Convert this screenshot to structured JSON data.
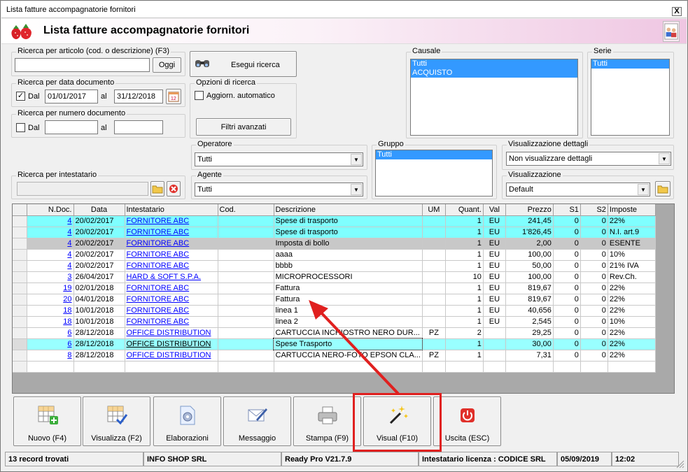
{
  "window": {
    "title": "Lista fatture accompagnatorie fornitori",
    "close_label": "X"
  },
  "header": {
    "title": "Lista fatture accompagnatorie fornitori"
  },
  "search_article": {
    "legend": "Ricerca per articolo (cod. o descrizione) (F3)",
    "value": "",
    "button": "Oggi"
  },
  "search_button": "Esegui ricerca",
  "search_date": {
    "legend": "Ricerca per data documento",
    "checked": true,
    "from_label": "Dal",
    "from": "01/01/2017",
    "to_label": "al",
    "to": "31/12/2018"
  },
  "search_number": {
    "legend": "Ricerca per numero documento",
    "checked": false,
    "from_label": "Dal",
    "from": "",
    "to_label": "al",
    "to": ""
  },
  "options": {
    "legend": "Opzioni di ricerca",
    "auto_update_label": "Aggiorn. automatico",
    "auto_update": false,
    "advanced_filters": "Filtri avanzati"
  },
  "causale": {
    "legend": "Causale",
    "items": [
      "Tutti",
      "ACQUISTO"
    ]
  },
  "serie": {
    "legend": "Serie",
    "items": [
      "Tutti"
    ]
  },
  "operatore": {
    "legend": "Operatore",
    "value": "Tutti"
  },
  "gruppo": {
    "legend": "Gruppo",
    "items": [
      "Tutti"
    ]
  },
  "vis_dettagli": {
    "legend": "Visualizzazione dettagli",
    "value": "Non visualizzare dettagli"
  },
  "intestatario": {
    "legend": "Ricerca per intestatario",
    "value": ""
  },
  "agente": {
    "legend": "Agente",
    "value": "Tutti"
  },
  "visualizzazione": {
    "legend": "Visualizzazione",
    "value": "Default"
  },
  "table": {
    "columns": [
      "N.Doc.",
      "Data",
      "Intestatario",
      "Cod.",
      "Descrizione",
      "UM",
      "Quant.",
      "Val",
      "Prezzo",
      "S1",
      "S2",
      "Imposte"
    ],
    "rows": [
      {
        "style": "cyan",
        "cells": [
          "4",
          "20/02/2017",
          "FORNITORE ABC",
          "",
          "Spese di trasporto",
          "",
          "1",
          "EU",
          "241,45",
          "0",
          "0",
          "22%"
        ]
      },
      {
        "style": "cyan",
        "cells": [
          "4",
          "20/02/2017",
          "FORNITORE ABC",
          "",
          "Spese di trasporto",
          "",
          "1",
          "EU",
          "1'826,45",
          "0",
          "0",
          "N.I. art.9"
        ]
      },
      {
        "style": "gray",
        "cells": [
          "4",
          "20/02/2017",
          "FORNITORE ABC",
          "",
          "Imposta di bollo",
          "",
          "1",
          "EU",
          "2,00",
          "0",
          "0",
          "ESENTE"
        ]
      },
      {
        "style": "",
        "cells": [
          "4",
          "20/02/2017",
          "FORNITORE ABC",
          "",
          "aaaa",
          "",
          "1",
          "EU",
          "100,00",
          "0",
          "0",
          "10%"
        ]
      },
      {
        "style": "",
        "cells": [
          "4",
          "20/02/2017",
          "FORNITORE ABC",
          "",
          "bbbb",
          "",
          "1",
          "EU",
          "50,00",
          "0",
          "0",
          "21% IVA"
        ]
      },
      {
        "style": "",
        "cells": [
          "3",
          "26/04/2017",
          "HARD & SOFT S.P.A.",
          "",
          "MICROPROCESSORI",
          "",
          "10",
          "EU",
          "100,00",
          "0",
          "0",
          "Rev.Ch."
        ]
      },
      {
        "style": "",
        "cells": [
          "19",
          "02/01/2018",
          "FORNITORE ABC",
          "",
          "Fattura",
          "",
          "1",
          "EU",
          "819,67",
          "0",
          "0",
          "22%"
        ]
      },
      {
        "style": "",
        "cells": [
          "20",
          "04/01/2018",
          "FORNITORE ABC",
          "",
          "Fattura",
          "",
          "1",
          "EU",
          "819,67",
          "0",
          "0",
          "22%"
        ]
      },
      {
        "style": "",
        "cells": [
          "18",
          "10/01/2018",
          "FORNITORE ABC",
          "",
          "linea 1",
          "",
          "1",
          "EU",
          "40,656",
          "0",
          "0",
          "22%"
        ]
      },
      {
        "style": "",
        "cells": [
          "18",
          "10/01/2018",
          "FORNITORE ABC",
          "",
          "linea 2",
          "",
          "1",
          "EU",
          "2,545",
          "0",
          "0",
          "10%"
        ]
      },
      {
        "style": "",
        "cells": [
          "6",
          "28/12/2018",
          "OFFICE DISTRIBUTION",
          "",
          "CARTUCCIA INCHIOSTRO NERO DUR...",
          "PZ",
          "2",
          "",
          "29,25",
          "0",
          "0",
          "22%"
        ]
      },
      {
        "style": "sel2",
        "cells": [
          "6",
          "28/12/2018",
          "OFFICE DISTRIBUTION",
          "",
          "Spese Trasporto",
          "",
          "1",
          "",
          "30,00",
          "0",
          "0",
          "22%"
        ]
      },
      {
        "style": "",
        "cells": [
          "8",
          "28/12/2018",
          "OFFICE DISTRIBUTION",
          "",
          "CARTUCCIA NERO-FOTO EPSON CLA...",
          "PZ",
          "1",
          "",
          "7,31",
          "0",
          "0",
          "22%"
        ]
      }
    ]
  },
  "toolbar": {
    "nuovo": "Nuovo (F4)",
    "visualizza": "Visualizza (F2)",
    "elaborazioni": "Elaborazioni",
    "messaggio": "Messaggio",
    "stampa": "Stampa (F9)",
    "visual": "Visual (F10)",
    "uscita": "Uscita (ESC)"
  },
  "status": {
    "records": "13 record trovati",
    "company": "INFO SHOP SRL",
    "version": "Ready Pro V21.7.9",
    "license": "Intestatario licenza : CODICE SRL",
    "date": "05/09/2019",
    "time": "12:02"
  },
  "colors": {
    "highlight": "#e0201f",
    "selection": "#3399ff",
    "row_cyan": "#7fffff",
    "link": "#0000ff"
  }
}
